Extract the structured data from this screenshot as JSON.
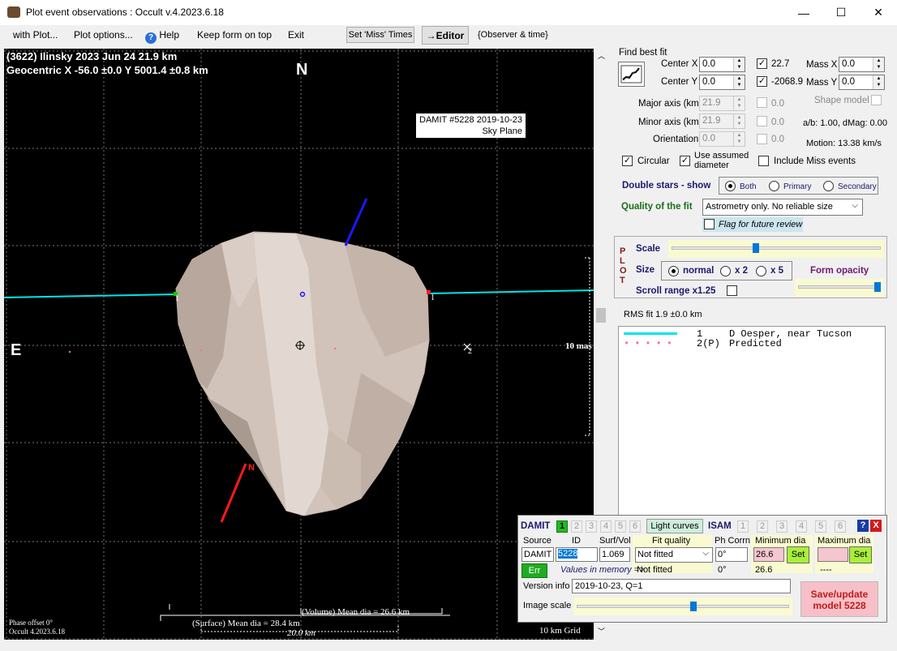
{
  "window": {
    "title": "Plot event observations : Occult v.4.2023.6.18",
    "minimize": "—",
    "maximize": "☐",
    "close": "✕"
  },
  "menu": {
    "with_plot": "with Plot...",
    "plot_options": "Plot options...",
    "help": "Help",
    "keep_on_top": "Keep form on top",
    "exit": "Exit",
    "set_miss_times": "Set 'Miss' Times",
    "editor": "→Editor",
    "observer_time": "{Observer & time}"
  },
  "plot": {
    "header_line1": "(3622) Ilinsky  2023 Jun 24   21.9 km",
    "header_line2": "Geocentric  X  -56.0 ±0.0  Y 5001.4 ±0.8 km",
    "north": "N",
    "east": "E",
    "damit_label_line1": "DAMIT #5228 2019-10-23",
    "damit_label_line2": "Sky Plane",
    "chord1_left_num": "1",
    "chord1_right_num": "1",
    "point2_num": "2",
    "north_pole_label": "N",
    "scale_mas": "10 mas",
    "phase_offset": "Phase offset 0°",
    "occult_version": "Occult 4.2023.6.18",
    "volume_mean_dia": "(Volume) Mean dia = 26.6 km",
    "surface_mean_dia": "(Surface) Mean dia = 28.4 km",
    "km_scale": "20.0 km",
    "grid_label": "10 km Grid",
    "colors": {
      "chord": "#00e5e5",
      "north_pole": "#ff0000",
      "axis_pole": "#1a1aff",
      "predicted": "#ff69b4",
      "shape": "#d9cbc3"
    }
  },
  "fit": {
    "title": "Find best fit",
    "center_x_label": "Center X",
    "center_x": "0.0",
    "center_y_label": "Center Y",
    "center_y": "0.0",
    "cx_value": "22.7",
    "cy_value": "-2068.9",
    "mass_x_label": "Mass X",
    "mass_x": "0.0",
    "mass_y_label": "Mass Y",
    "mass_y": "0.0",
    "major_axis_label": "Major axis (km)",
    "major_axis": "21.9",
    "major_val": "0.0",
    "minor_axis_label": "Minor axis (km)",
    "minor_axis": "21.9",
    "minor_val": "0.0",
    "orientation_label": "Orientation",
    "orientation": "0.0",
    "orient_val": "0.0",
    "shape_model_label": "Shape model",
    "ab_dmag": "a/b: 1.00, dMag: 0.00",
    "motion": "Motion: 13.38 km/s",
    "circular": "Circular",
    "use_assumed_1": "Use assumed",
    "use_assumed_2": "diameter",
    "include_miss": "Include Miss events",
    "double_stars": "Double stars - show",
    "both": "Both",
    "primary": "Primary",
    "secondary": "Secondary",
    "quality_label": "Quality of the fit",
    "quality_value": "Astrometry only. No reliable size",
    "flag_review": "Flag for future review"
  },
  "plotpanel": {
    "p": "P",
    "l": "L",
    "o": "O",
    "t": "T",
    "scale_label": "Scale",
    "scale_level": 0.4,
    "size_label": "Size",
    "normal": "normal",
    "x2": "x 2",
    "x5": "x 5",
    "form_opacity": "Form opacity",
    "scroll_range": "Scroll range x1.25",
    "opacity_level": 1.0
  },
  "rms": "RMS fit 1.9 ±0.0 km",
  "legend": [
    {
      "num": "1",
      "text": "D Oesper, near Tucson"
    },
    {
      "num": "2(P)",
      "text": "Predicted"
    }
  ],
  "damit": {
    "damit_label": "DAMIT",
    "nums": [
      "1",
      "2",
      "3",
      "4",
      "5",
      "6"
    ],
    "light_curves": "Light curves",
    "isam_label": "ISAM",
    "isam_nums": [
      "1",
      "2",
      "3",
      "4",
      "5",
      "6"
    ],
    "help": "?",
    "close": "X",
    "source_hdr": "Source",
    "id_hdr": "ID",
    "surfvol_hdr": "Surf/Vol",
    "fitq_hdr": "Fit quality",
    "phcorr_hdr": "Ph Corrn",
    "mindia_hdr": "Minimum dia",
    "maxdia_hdr": "Maximum dia",
    "source": "DAMIT",
    "id": "5228",
    "surfvol": "1.069",
    "fit_quality": "Not fitted",
    "phcorr": "0°",
    "mindia": "26.6",
    "set": "Set",
    "set2": "Set",
    "err": "Err",
    "values_mem": "Values in memory =>",
    "mem_fit": "Not fitted",
    "mem_ph": "0°",
    "mem_min": "26.6",
    "mem_max": "----",
    "version_label": "Version info",
    "version": "2019-10-23, Q=1",
    "image_scale": "Image scale",
    "image_scale_level": 0.55,
    "save_line1": "Save/update",
    "save_line2": "model 5228"
  }
}
